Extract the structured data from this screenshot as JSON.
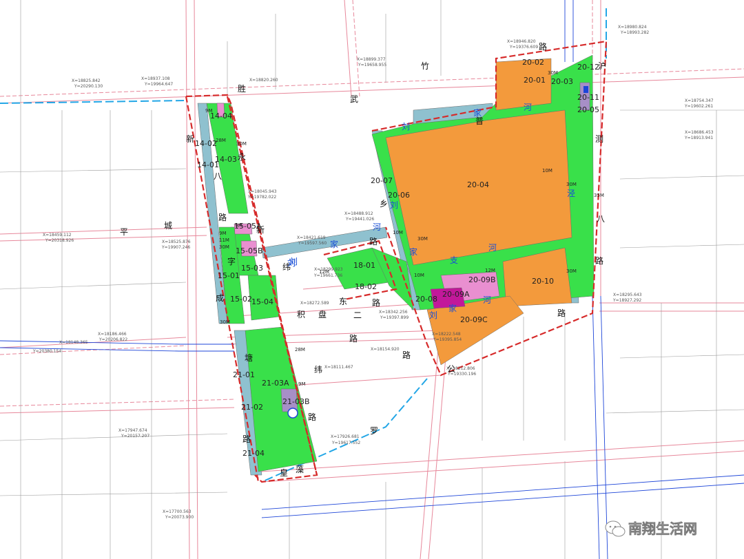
{
  "map": {
    "colors": {
      "residential": "#f39a3c",
      "green": "#39e04a",
      "water": "#8fc1cf",
      "school": "#e98fd0",
      "commercial": "#c2189a",
      "utility": "#a78fc7",
      "boundary": "#d62a2a",
      "road_line": "#e7879a",
      "base_line": "#9a9a9a",
      "river_line": "#1d45d8"
    },
    "parcels": [
      {
        "id": "14-01",
        "label": "14-01"
      },
      {
        "id": "14-02",
        "label": "14-02"
      },
      {
        "id": "14-03",
        "label": "14-03"
      },
      {
        "id": "14-04",
        "label": "14-04"
      },
      {
        "id": "15-01",
        "label": "15-01"
      },
      {
        "id": "15-02",
        "label": "15-02"
      },
      {
        "id": "15-03",
        "label": "15-03"
      },
      {
        "id": "15-04",
        "label": "15-04"
      },
      {
        "id": "15-05A",
        "label": "15-05A"
      },
      {
        "id": "15-05B",
        "label": "15-05B"
      },
      {
        "id": "18-01",
        "label": "18-01"
      },
      {
        "id": "18-02",
        "label": "18-02"
      },
      {
        "id": "20-01",
        "label": "20-01"
      },
      {
        "id": "20-02",
        "label": "20-02"
      },
      {
        "id": "20-03",
        "label": "20-03"
      },
      {
        "id": "20-04",
        "label": "20-04"
      },
      {
        "id": "20-05",
        "label": "20-05"
      },
      {
        "id": "20-06",
        "label": "20-06"
      },
      {
        "id": "20-07",
        "label": "20-07"
      },
      {
        "id": "20-08",
        "label": "20-08"
      },
      {
        "id": "20-09A",
        "label": "20-09A"
      },
      {
        "id": "20-09B",
        "label": "20-09B"
      },
      {
        "id": "20-09C",
        "label": "20-09C"
      },
      {
        "id": "20-10",
        "label": "20-10"
      },
      {
        "id": "20-11",
        "label": "20-11"
      },
      {
        "id": "20-12",
        "label": "20-12"
      },
      {
        "id": "21-01",
        "label": "21-01"
      },
      {
        "id": "21-02",
        "label": "21-02"
      },
      {
        "id": "21-03A",
        "label": "21-03A"
      },
      {
        "id": "21-03B",
        "label": "21-03B"
      },
      {
        "id": "21-04",
        "label": "21-04"
      }
    ],
    "road_names": [
      {
        "id": "zhu",
        "text": "竹"
      },
      {
        "id": "sheng",
        "text": "胜"
      },
      {
        "id": "wu",
        "text": "武"
      },
      {
        "id": "lu-top",
        "text": "路"
      },
      {
        "id": "xin1",
        "text": "新"
      },
      {
        "id": "yong",
        "text": "永"
      },
      {
        "id": "ba",
        "text": "八"
      },
      {
        "id": "lu-l1",
        "text": "路"
      },
      {
        "id": "ping",
        "text": "平"
      },
      {
        "id": "cheng",
        "text": "城"
      },
      {
        "id": "xin2",
        "text": "新"
      },
      {
        "id": "zi",
        "text": "字"
      },
      {
        "id": "cheng2",
        "text": "成"
      },
      {
        "id": "lu-l2",
        "text": "路"
      },
      {
        "id": "wei",
        "text": "纬"
      },
      {
        "id": "ji",
        "text": "积"
      },
      {
        "id": "pan",
        "text": "盘"
      },
      {
        "id": "dong",
        "text": "东"
      },
      {
        "id": "er",
        "text": "二"
      },
      {
        "id": "lu-c1",
        "text": "路"
      },
      {
        "id": "lu-c2",
        "text": "路"
      },
      {
        "id": "lu-c3",
        "text": "路"
      },
      {
        "id": "tang",
        "text": "塘"
      },
      {
        "id": "wei2",
        "text": "纬"
      },
      {
        "id": "luo",
        "text": "罗"
      },
      {
        "id": "lu-b1",
        "text": "路"
      },
      {
        "id": "lu-b2",
        "text": "路"
      },
      {
        "id": "huang",
        "text": "皇"
      },
      {
        "id": "zao",
        "text": "藻"
      },
      {
        "id": "gong",
        "text": "公"
      },
      {
        "id": "ce",
        "text": "测"
      },
      {
        "id": "ba2",
        "text": "八"
      },
      {
        "id": "lu-r",
        "text": "路"
      },
      {
        "id": "xian",
        "text": "沪"
      },
      {
        "id": "lu-s",
        "text": "路"
      },
      {
        "id": "pu",
        "text": "普"
      },
      {
        "id": "xiang",
        "text": "乡"
      }
    ],
    "water_names": [
      {
        "id": "liu1",
        "text": "刘"
      },
      {
        "id": "jia1",
        "text": "家"
      },
      {
        "id": "he1",
        "text": "河"
      },
      {
        "id": "jing",
        "text": "泾"
      },
      {
        "id": "liu2",
        "text": "刘"
      },
      {
        "id": "he2",
        "text": "河"
      },
      {
        "id": "jia2",
        "text": "家"
      },
      {
        "id": "liu3",
        "text": "刘"
      },
      {
        "id": "jia3",
        "text": "家"
      },
      {
        "id": "zhi",
        "text": "支"
      },
      {
        "id": "he3",
        "text": "河"
      },
      {
        "id": "liu4",
        "text": "刘"
      },
      {
        "id": "jia4",
        "text": "家"
      },
      {
        "id": "he4",
        "text": "河"
      },
      {
        "id": "liu5",
        "text": "刘"
      }
    ],
    "widths": [
      {
        "id": "w1",
        "text": "30M"
      },
      {
        "id": "w2",
        "text": "30M"
      },
      {
        "id": "w3",
        "text": "10M"
      },
      {
        "id": "w4",
        "text": "10M"
      },
      {
        "id": "w5",
        "text": "30M"
      },
      {
        "id": "w6",
        "text": "35M"
      },
      {
        "id": "w7",
        "text": "10M"
      },
      {
        "id": "w8",
        "text": "30M"
      },
      {
        "id": "w9",
        "text": "12M"
      },
      {
        "id": "w10",
        "text": "9M"
      },
      {
        "id": "w11",
        "text": "28M"
      },
      {
        "id": "w12",
        "text": "30M"
      },
      {
        "id": "w13",
        "text": "9M"
      },
      {
        "id": "w14",
        "text": "30M"
      },
      {
        "id": "w15",
        "text": "12M"
      },
      {
        "id": "w16",
        "text": "11M"
      },
      {
        "id": "w17",
        "text": "30M"
      },
      {
        "id": "w18",
        "text": "9M"
      },
      {
        "id": "w19",
        "text": "28M"
      },
      {
        "id": "w20",
        "text": "9M"
      }
    ],
    "coordinates": [
      {
        "id": "c1",
        "text": "X=18946.820"
      },
      {
        "id": "c2",
        "text": "Y=19376.609"
      },
      {
        "id": "c3",
        "text": "X=18899.377"
      },
      {
        "id": "c4",
        "text": "Y=19658.955"
      },
      {
        "id": "c5",
        "text": "X=18937.108"
      },
      {
        "id": "c6",
        "text": "Y=19964.647"
      },
      {
        "id": "c7",
        "text": "X=18825.842"
      },
      {
        "id": "c8",
        "text": "Y=20290.130"
      },
      {
        "id": "c9",
        "text": "X=18820.260"
      },
      {
        "id": "c10",
        "text": "X=18045.943"
      },
      {
        "id": "c11",
        "text": "Y=19782.022"
      },
      {
        "id": "c12",
        "text": "X=18488.912"
      },
      {
        "id": "c13",
        "text": "Y=19441.026"
      },
      {
        "id": "c14",
        "text": "X=18421.619"
      },
      {
        "id": "c15",
        "text": "Y=19597.560"
      },
      {
        "id": "c16",
        "text": "X=18459.112"
      },
      {
        "id": "c17",
        "text": "Y=20318.926"
      },
      {
        "id": "c18",
        "text": "X=18525.876"
      },
      {
        "id": "c19",
        "text": "Y=19907.246"
      },
      {
        "id": "c20",
        "text": "X=18299.923"
      },
      {
        "id": "c21",
        "text": "Y=19661.736"
      },
      {
        "id": "c22",
        "text": "X=18272.589"
      },
      {
        "id": "c23",
        "text": "X=18342.256"
      },
      {
        "id": "c24",
        "text": "Y=19397.899"
      },
      {
        "id": "c25",
        "text": "X=18186.466"
      },
      {
        "id": "c26",
        "text": "Y=20206.822"
      },
      {
        "id": "c27",
        "text": "X=18148.365"
      },
      {
        "id": "c28",
        "text": "Y=20380.154"
      },
      {
        "id": "c29",
        "text": "X=18154.920"
      },
      {
        "id": "c30",
        "text": "X=18111.467"
      },
      {
        "id": "c31",
        "text": "X=17947.674"
      },
      {
        "id": "c32",
        "text": "Y=20157.207"
      },
      {
        "id": "c33",
        "text": "X=17926.681"
      },
      {
        "id": "c34",
        "text": "Y=19617.552"
      },
      {
        "id": "c35",
        "text": "X=17700.563"
      },
      {
        "id": "c36",
        "text": "Y=20073.900"
      },
      {
        "id": "c37",
        "text": "X=18754.347"
      },
      {
        "id": "c38",
        "text": "Y=19602.261"
      },
      {
        "id": "c39",
        "text": "X=18686.453"
      },
      {
        "id": "c40",
        "text": "Y=18913.941"
      },
      {
        "id": "c41",
        "text": "X=18295.643"
      },
      {
        "id": "c42",
        "text": "Y=18927.292"
      },
      {
        "id": "c43",
        "text": "X=18222.548"
      },
      {
        "id": "c44",
        "text": "Y=19395.854"
      },
      {
        "id": "c45",
        "text": "X=18212.806"
      },
      {
        "id": "c46",
        "text": "Y=19330.196"
      },
      {
        "id": "c47",
        "text": "X=18980.824"
      },
      {
        "id": "c48",
        "text": "Y=18993.282"
      }
    ],
    "watermark": "南翔生活网",
    "icons": [
      "wechat-icon",
      "utility-p-icon",
      "utility-hj-icon"
    ]
  }
}
